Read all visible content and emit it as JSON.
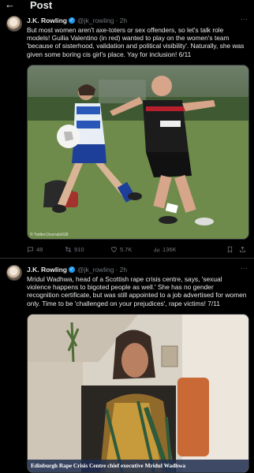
{
  "header": {
    "back_icon": "arrow-left-icon",
    "title": "Post"
  },
  "tweets": [
    {
      "author": "J.K. Rowling",
      "handle": "@jk_rowling",
      "time": "· 2h",
      "text": "But most women aren't axe-toters or sex offenders, so let's talk role models! Guilia Valentino (in red) wanted to play on the women's team 'because of sisterhood, validation and political visibility'. Naturally, she was given some boring cis girl's place. Yay for inclusion! 6/11",
      "image_watermark": "© Twitter/JournalsIGB",
      "replies": "48",
      "retweets": "910",
      "likes": "5.7K",
      "views": "136K"
    },
    {
      "author": "J.K. Rowling",
      "handle": "@jk_rowling",
      "time": "· 2h",
      "text": "Mridul Wadhwa, head of a Scottish rape crisis centre, says, 'sexual violence happens to bigoted people as well.' She has no gender recognition certificate, but was still appointed to a job advertised for women only. Time to be 'challenged on your prejudices', rape victims! 7/11",
      "image_caption": "Edinburgh Rape Crisis Centre chief executive Mridul Wadhwa"
    }
  ],
  "colors": {
    "background": "#000000",
    "text": "#e7e9ea",
    "muted": "#71767b",
    "verified": "#1d9bf0"
  }
}
